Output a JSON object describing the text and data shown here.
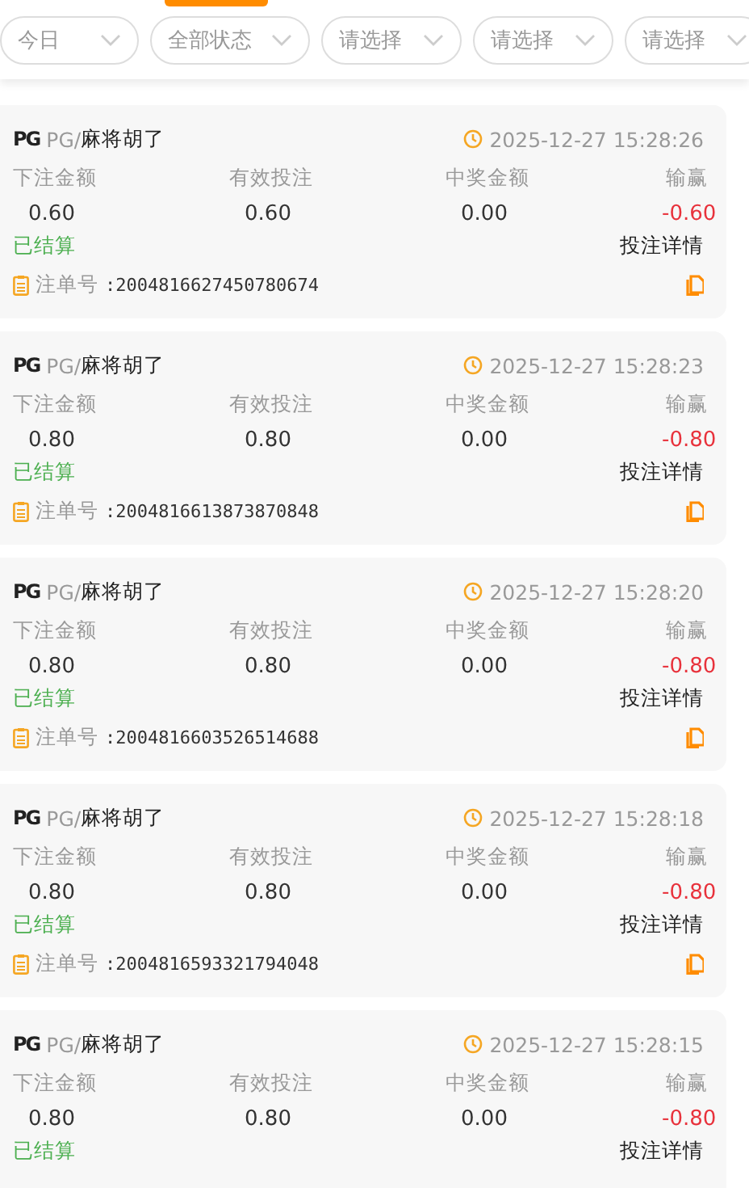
{
  "filters": [
    {
      "label": "今日"
    },
    {
      "label": "全部状态"
    },
    {
      "label": "请选择"
    },
    {
      "label": "请选择"
    },
    {
      "label": "请选择"
    }
  ],
  "bets": [
    {
      "logo": "PG",
      "provider": "PG/",
      "game": "麻将胡了",
      "time": "2025-12-27 15:28:26",
      "column_labels": [
        "下注金额",
        "有效投注",
        "中奖金额",
        "输赢"
      ],
      "bet": "0.60",
      "valid": "0.60",
      "win": "0.00",
      "profit": "-0.60",
      "status": "已结算",
      "details": "投注详情",
      "order_label": "注单号",
      "order_no": ":2004816627450780674"
    },
    {
      "logo": "PG",
      "provider": "PG/",
      "game": "麻将胡了",
      "time": "2025-12-27 15:28:23",
      "column_labels": [
        "下注金额",
        "有效投注",
        "中奖金额",
        "输赢"
      ],
      "bet": "0.80",
      "valid": "0.80",
      "win": "0.00",
      "profit": "-0.80",
      "status": "已结算",
      "details": "投注详情",
      "order_label": "注单号",
      "order_no": ":2004816613873870848"
    },
    {
      "logo": "PG",
      "provider": "PG/",
      "game": "麻将胡了",
      "time": "2025-12-27 15:28:20",
      "column_labels": [
        "下注金额",
        "有效投注",
        "中奖金额",
        "输赢"
      ],
      "bet": "0.80",
      "valid": "0.80",
      "win": "0.00",
      "profit": "-0.80",
      "status": "已结算",
      "details": "投注详情",
      "order_label": "注单号",
      "order_no": ":2004816603526514688"
    },
    {
      "logo": "PG",
      "provider": "PG/",
      "game": "麻将胡了",
      "time": "2025-12-27 15:28:18",
      "column_labels": [
        "下注金额",
        "有效投注",
        "中奖金额",
        "输赢"
      ],
      "bet": "0.80",
      "valid": "0.80",
      "win": "0.00",
      "profit": "-0.80",
      "status": "已结算",
      "details": "投注详情",
      "order_label": "注单号",
      "order_no": ":2004816593321794048"
    },
    {
      "logo": "PG",
      "provider": "PG/",
      "game": "麻将胡了",
      "time": "2025-12-27 15:28:15",
      "column_labels": [
        "下注金额",
        "有效投注",
        "中奖金额",
        "输赢"
      ],
      "bet": "0.80",
      "valid": "0.80",
      "win": "0.00",
      "profit": "-0.80",
      "status": "已结算",
      "details": "投注详情"
    }
  ]
}
